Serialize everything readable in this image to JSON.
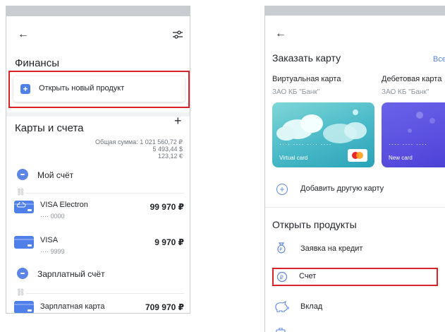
{
  "left": {
    "back_icon": "←",
    "section_title": "Финансы",
    "open_product_button": "Открыть новый продукт",
    "cards_title": "Карты и счета",
    "add_icon": "+",
    "total_label": "Общая сумма: 1 021 560,72 ₽",
    "total_usd": "5 493,44 $",
    "total_eur": "123,12 €",
    "accounts": [
      {
        "name": "Мой счёт"
      },
      {
        "name": "Зарплатный счёт"
      }
    ],
    "cards": [
      {
        "name": "VISA Electron",
        "number": "···· 0000",
        "amount": "99 970 ₽"
      },
      {
        "name": "VISA",
        "number": "···· 9999",
        "amount": "9 970 ₽"
      },
      {
        "name": "Зарплатная карта",
        "amount": "709 970 ₽"
      }
    ]
  },
  "right": {
    "back_icon": "←",
    "order_title": "Заказать карту",
    "all_link": "Все",
    "card_types": [
      {
        "title": "Виртуальная карта",
        "bank": "ЗАО КБ \"Банк\"",
        "card_label": "Virtual card",
        "card_number": "···· ···· ···· ····"
      },
      {
        "title": "Дебетовая карта",
        "bank": "ЗАО КБ \"Банк\"",
        "card_label": "New card",
        "card_number": "···· ···· ····"
      }
    ],
    "add_other_card": "Добавить другую карту",
    "products_title": "Открыть продукты",
    "products": [
      {
        "label": "Заявка на кредит",
        "icon": "money-bag-icon"
      },
      {
        "label": "Счет",
        "icon": "ruble-coin-icon"
      },
      {
        "label": "Вклад",
        "icon": "piggy-bank-icon"
      }
    ]
  },
  "colors": {
    "accent": "#5b86e5",
    "highlight": "#d8232a",
    "topbar": "#c9ccd1"
  }
}
